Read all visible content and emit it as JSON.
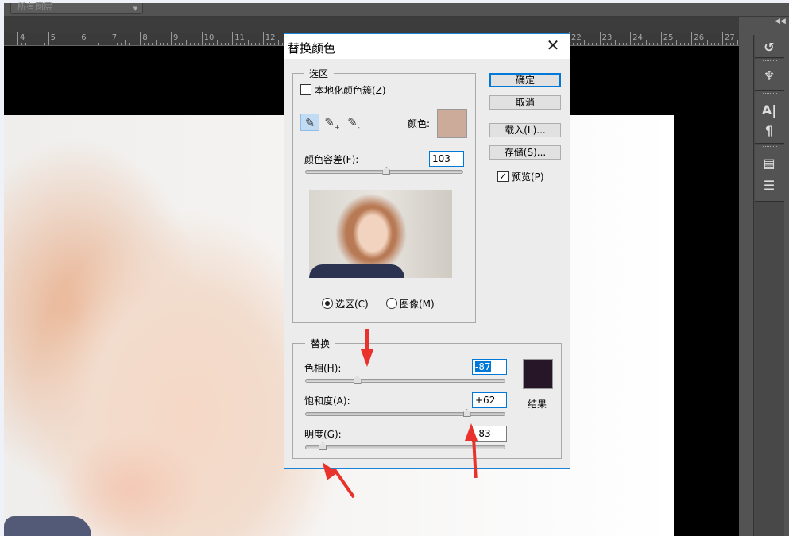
{
  "app": {
    "layer_select": "所有图层",
    "ruler_labels": [
      "4",
      "5",
      "6",
      "7",
      "8",
      "9",
      "10",
      "11",
      "12",
      "22",
      "23",
      "24",
      "25",
      "26",
      "27"
    ]
  },
  "dialog": {
    "title": "替换颜色",
    "selection": {
      "legend": "选区",
      "localized_clusters_label": "本地化颜色簇(Z)",
      "localized_clusters_checked": false,
      "color_label": "颜色:",
      "color_swatch": "#ccab9b",
      "fuzziness_label": "颜色容差(F):",
      "fuzziness_value": "103",
      "fuzziness_fraction": 0.515,
      "radio_selection": "选区(C)",
      "radio_image": "图像(M)",
      "selected_view": "选区(C)"
    },
    "replace": {
      "legend": "替换",
      "hue_label": "色相(H):",
      "hue_value": "-87",
      "hue_fraction": 0.258,
      "saturation_label": "饱和度(A):",
      "saturation_value": "+62",
      "saturation_fraction": 0.81,
      "lightness_label": "明度(G):",
      "lightness_value": "-83",
      "lightness_fraction": 0.085,
      "result_label": "结果",
      "result_swatch": "#261627"
    },
    "buttons": {
      "ok": "确定",
      "cancel": "取消",
      "load": "载入(L)...",
      "save": "存储(S)..."
    },
    "preview_label": "预览(P)",
    "preview_checked": true
  }
}
